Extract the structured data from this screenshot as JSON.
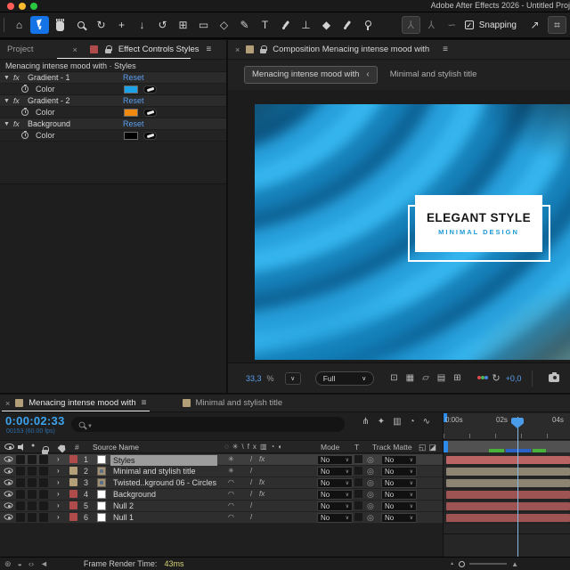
{
  "window": {
    "title": "Adobe After Effects 2026 - Untitled Proj",
    "traffic_lights": [
      {
        "name": "close-button",
        "color": "#ff5f57"
      },
      {
        "name": "minimize-button",
        "color": "#febc2e"
      },
      {
        "name": "zoom-button",
        "color": "#2ac840"
      }
    ]
  },
  "toolbar": {
    "tools": [
      {
        "name": "home-tool",
        "glyph": "⌂"
      },
      {
        "name": "selection-tool",
        "icon": "cursor",
        "active": true
      },
      {
        "name": "hand-tool",
        "icon": "hand"
      },
      {
        "name": "zoom-tool",
        "icon": "mag"
      },
      {
        "name": "orbit-camera-tool",
        "glyph": "↻"
      },
      {
        "name": "pan-camera-tool",
        "glyph": "+"
      },
      {
        "name": "dolly-camera-tool",
        "glyph": "↓"
      },
      {
        "name": "rotation-tool",
        "glyph": "↺"
      },
      {
        "name": "pan-behind-tool",
        "glyph": "⊞"
      },
      {
        "name": "rectangle-tool",
        "glyph": "▭"
      },
      {
        "name": "shape-tool",
        "glyph": "◇"
      },
      {
        "name": "pen-tool",
        "glyph": "✎"
      },
      {
        "name": "type-tool",
        "glyph": "T"
      },
      {
        "name": "brush-tool",
        "icon": "brush"
      },
      {
        "name": "clone-stamp-tool",
        "glyph": "⊥"
      },
      {
        "name": "eraser-tool",
        "glyph": "◆"
      },
      {
        "name": "roto-brush-tool",
        "icon": "brush"
      },
      {
        "name": "puppet-pin-tool",
        "icon": "pin"
      }
    ],
    "right_tools": [
      {
        "name": "rig-node-tool",
        "glyph": "⅄",
        "pressed": true,
        "dim": true
      },
      {
        "name": "rig-point-tool",
        "glyph": "⅄",
        "dim": true
      },
      {
        "name": "lasso-tool",
        "glyph": "∽",
        "dim": true
      }
    ],
    "snapping_label": "Snapping",
    "snap_arrow_icon": "↗",
    "snap_options_icon": "⌗"
  },
  "effect_controls": {
    "inactive_tab": "Project",
    "active_tab": "Effect Controls Styles",
    "layer_label_color": "#b04b4b",
    "subtitle": "Menacing intense mood with · Styles",
    "reset_label": "Reset",
    "effects": [
      {
        "name": "Gradient - 1",
        "property": "Color",
        "color": "#1ba2e8"
      },
      {
        "name": "Gradient - 2",
        "property": "Color",
        "color": "#f08a0e"
      },
      {
        "name": "Background",
        "property": "Color",
        "color": "#000000"
      }
    ]
  },
  "composition": {
    "header_title": "Composition Menacing intense mood with",
    "label_color": "#b3a078",
    "tab_active": "Menacing intense mood with",
    "tab_active_chevron": "‹",
    "tab_inactive": "Minimal and stylish title",
    "zoom_value": "33,3",
    "zoom_percent": "%",
    "resolution": "Full",
    "exposure": "+0,0",
    "view_icons": [
      {
        "name": "region-of-interest-icon",
        "glyph": "⊡"
      },
      {
        "name": "transparency-grid-icon",
        "glyph": "▦"
      },
      {
        "name": "mask-visibility-icon",
        "glyph": "▱"
      },
      {
        "name": "guides-options-icon",
        "glyph": "▤"
      },
      {
        "name": "composition-flowchart-icon",
        "glyph": "⊞"
      }
    ],
    "overlay": {
      "title": "ELEGANT STYLE",
      "subtitle": "MINIMAL DESIGN",
      "accent_color": "#1e9ad6"
    }
  },
  "timeline": {
    "tab_active": "Menacing intense mood with",
    "tab_inactive": "Minimal and stylish title",
    "comp_label_color": "#b3a078",
    "timecode": "0:00:02:33",
    "frames_info": "00153 (60.00 fps)",
    "toolbar_icons": [
      {
        "name": "mini-flowchart-icon",
        "glyph": "⋔"
      },
      {
        "name": "draft-3d-icon",
        "glyph": "✦"
      },
      {
        "name": "frame-blending-icon",
        "glyph": "▥"
      },
      {
        "name": "motion-blur-icon",
        "glyph": "◔"
      },
      {
        "name": "graph-editor-icon",
        "glyph": "∿"
      }
    ],
    "columns": {
      "source_name": "Source Name",
      "mode": "Mode",
      "t": "T",
      "track_matte": "Track Matte",
      "number_sign": "#"
    },
    "switch_header_icons": [
      {
        "name": "shy-icon",
        "glyph": "◌"
      },
      {
        "name": "collapse-transformations-icon",
        "glyph": "✳"
      },
      {
        "name": "quality-icon",
        "glyph": "\\"
      },
      {
        "name": "fx-header-icon",
        "glyph": "fx"
      },
      {
        "name": "frame-blend-icon",
        "glyph": "▥"
      },
      {
        "name": "motion-blur-icon",
        "glyph": "◔"
      },
      {
        "name": "adjustment-layer-icon",
        "glyph": "◐"
      }
    ],
    "pane_toggle_icons": [
      {
        "name": "transfer-pane-toggle-icon",
        "glyph": "◱"
      },
      {
        "name": "switches-pane-toggle-icon",
        "glyph": "◪"
      }
    ],
    "mode_value": "No",
    "track_matte_value": "No",
    "ruler_labels": [
      "0:00s",
      "02s",
      "04s"
    ],
    "label_colors": {
      "red": "#b04b4b",
      "tan": "#b3a078"
    },
    "layers": [
      {
        "num": "1",
        "name": "Styles",
        "label": "red",
        "icon": "solid",
        "selected": true,
        "switch_a": "✳",
        "fx": true
      },
      {
        "num": "2",
        "name": "Minimal and stylish title",
        "label": "tan",
        "icon": "comp",
        "selected": false,
        "switch_a": "✳",
        "fx": false
      },
      {
        "num": "3",
        "name": "Twisted..kground 06 - Circles",
        "label": "tan",
        "icon": "comp",
        "selected": false,
        "switch_a": "◠",
        "fx": true
      },
      {
        "num": "4",
        "name": "Background",
        "label": "red",
        "icon": "solid",
        "selected": false,
        "switch_a": "◠",
        "fx": true
      },
      {
        "num": "5",
        "name": "Null 2",
        "label": "red",
        "icon": "solid",
        "selected": false,
        "switch_a": "◠",
        "fx": false
      },
      {
        "num": "6",
        "name": "Null 1",
        "label": "red",
        "icon": "solid",
        "selected": false,
        "switch_a": "◠",
        "fx": false
      }
    ]
  },
  "statusbar": {
    "icons": [
      {
        "name": "globe-circle-icon",
        "glyph": "⊛"
      },
      {
        "name": "half-circle-icon",
        "glyph": "◒"
      },
      {
        "name": "angle-brackets-icon",
        "glyph": "‹›"
      },
      {
        "name": "speaker-flag-icon",
        "glyph": "◄"
      }
    ],
    "label": "Frame Render Time:",
    "value": "43ms"
  }
}
